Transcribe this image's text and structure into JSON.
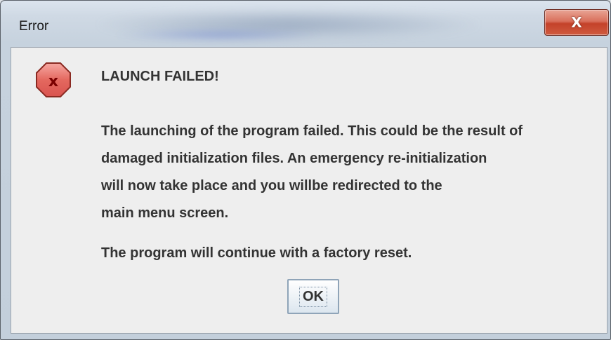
{
  "window": {
    "title": "Error",
    "close_label": "X"
  },
  "dialog": {
    "heading": "LAUNCH FAILED!",
    "body_lines": [
      "The launching of the program failed. This could be the result of",
      "damaged initialization files. An emergency re-initialization",
      "will now take place and you willbe redirected to the",
      "main menu screen."
    ],
    "footer": "The program will continue with a factory reset.",
    "ok_label": "OK"
  },
  "colors": {
    "error_icon": "#d9534f",
    "close_button": "#c4422a"
  }
}
